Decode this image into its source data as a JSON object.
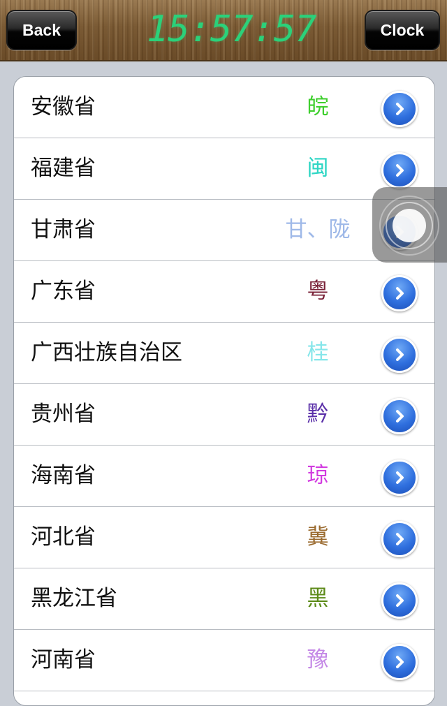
{
  "header": {
    "back_label": "Back",
    "time": "15:57:57",
    "clock_label": "Clock"
  },
  "provinces": [
    {
      "name": "安徽省",
      "abbr": "皖",
      "color": "#3fcf2e"
    },
    {
      "name": "福建省",
      "abbr": "闽",
      "color": "#2ed6c4"
    },
    {
      "name": "甘肃省",
      "abbr": "甘、陇",
      "color": "#9fb9e8"
    },
    {
      "name": "广东省",
      "abbr": "粤",
      "color": "#7a2238"
    },
    {
      "name": "广西壮族自治区",
      "abbr": "桂",
      "color": "#86e6ea"
    },
    {
      "name": "贵州省",
      "abbr": "黔",
      "color": "#5a2fa8"
    },
    {
      "name": "海南省",
      "abbr": "琼",
      "color": "#d23be0"
    },
    {
      "name": "河北省",
      "abbr": "冀",
      "color": "#9a6a2e"
    },
    {
      "name": "黑龙江省",
      "abbr": "黑",
      "color": "#5c8a18"
    },
    {
      "name": "河南省",
      "abbr": "豫",
      "color": "#c488e6"
    }
  ],
  "icons": {
    "disclosure": "chevron-right-icon",
    "assistive_touch": "assistive-touch-icon"
  }
}
